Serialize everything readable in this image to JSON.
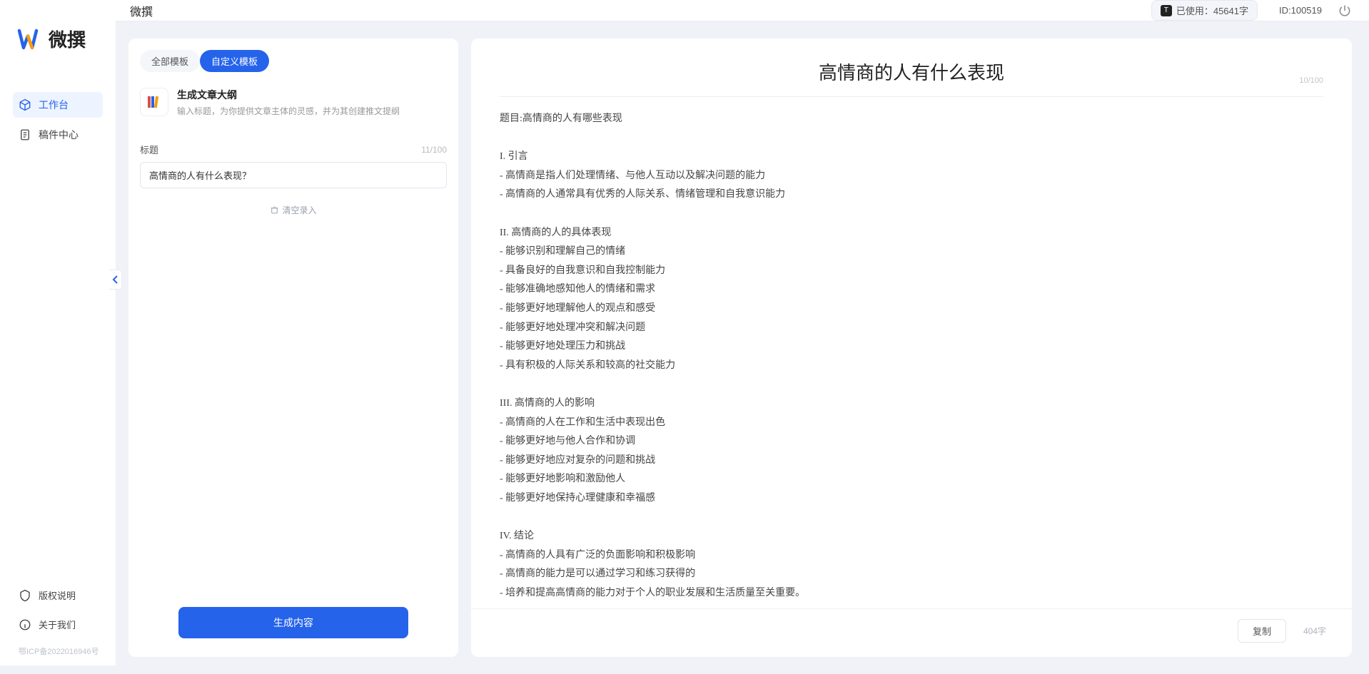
{
  "app_name": "微撰",
  "sidebar": {
    "logo_text": "微撰",
    "nav": [
      {
        "label": "工作台",
        "icon": "cube"
      },
      {
        "label": "稿件中心",
        "icon": "doc"
      }
    ],
    "bottom": [
      {
        "label": "版权说明",
        "icon": "shield"
      },
      {
        "label": "关于我们",
        "icon": "info"
      }
    ],
    "icp": "鄂ICP备2022016946号"
  },
  "topbar": {
    "title": "微撰",
    "usage_prefix": "已使用：",
    "usage_value": "45641字",
    "id_label": "ID:100519"
  },
  "left_panel": {
    "tab_all": "全部模板",
    "tab_custom": "自定义模板",
    "template_title": "生成文章大纲",
    "template_desc": "输入标题，为你提供文章主体的灵感，并为其创建推文提纲",
    "field_label": "标题",
    "field_counter": "11/100",
    "input_value": "高情商的人有什么表现？",
    "clear_label": "清空录入",
    "generate_label": "生成内容"
  },
  "right_panel": {
    "title": "高情商的人有什么表现",
    "head_counter": "10/100",
    "body": "题目:高情商的人有哪些表现\n\nI. 引言\n- 高情商是指人们处理情绪、与他人互动以及解决问题的能力\n- 高情商的人通常具有优秀的人际关系、情绪管理和自我意识能力\n\nII. 高情商的人的具体表现\n- 能够识别和理解自己的情绪\n- 具备良好的自我意识和自我控制能力\n- 能够准确地感知他人的情绪和需求\n- 能够更好地理解他人的观点和感受\n- 能够更好地处理冲突和解决问题\n- 能够更好地处理压力和挑战\n- 具有积极的人际关系和较高的社交能力\n\nIII. 高情商的人的影响\n- 高情商的人在工作和生活中表现出色\n- 能够更好地与他人合作和协调\n- 能够更好地应对复杂的问题和挑战\n- 能够更好地影响和激励他人\n- 能够更好地保持心理健康和幸福感\n\nIV. 结论\n- 高情商的人具有广泛的负面影响和积极影响\n- 高情商的能力是可以通过学习和练习获得的\n- 培养和提高高情商的能力对于个人的职业发展和生活质量至关重要。",
    "copy_label": "复制",
    "word_count": "404字"
  }
}
